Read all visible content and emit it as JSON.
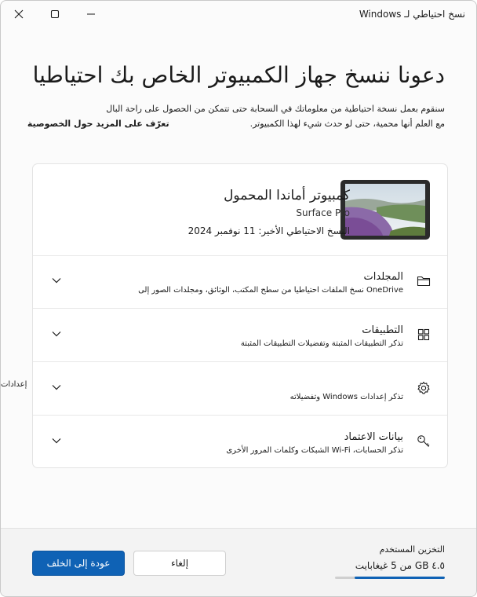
{
  "window": {
    "title": "نسخ احتياطي لـ Windows"
  },
  "heading": "دعونا ننسخ جهاز الكمبيوتر الخاص بك احتياطيا",
  "description": {
    "line1": "سنقوم بعمل نسخة احتياطية من معلوماتك في السحابة حتى تتمكن من الحصول على راحة البال",
    "line2": "مع العلم أنها محمية، حتى لو حدث شيء لهذا الكمبيوتر.",
    "privacy_link": "تعرّف على المزيد حول الخصوصية"
  },
  "device": {
    "name": "كمبيوتر أماندا المحمول",
    "model": "Surface Pro",
    "last_backup": "النسخ الاحتياطي الأخير: 11 نوفمبر 2024"
  },
  "sections": [
    {
      "title": "المجلدات",
      "subtitle": "OneDrive نسخ الملفات احتياطيا من سطح المكتب، الوثائق، ومجلدات الصور إلى",
      "icon": "folder-icon"
    },
    {
      "title": "التطبيقات",
      "subtitle": "تذكر التطبيقات المثبتة وتفضيلات التطبيقات المثبتة",
      "icon": "apps-icon"
    },
    {
      "title": "",
      "subtitle": "تذكر إعدادات Windows وتفضيلاته",
      "overflow": "إعدادات",
      "icon": "gear-icon"
    },
    {
      "title": "بيانات الاعتماد",
      "subtitle": "تذكر الحسابات، Wi-Fi الشبكات وكلمات المرور الأخرى",
      "icon": "key-icon"
    }
  ],
  "footer": {
    "storage_label": "التخزين المستخدم",
    "storage_value": "٤.٥ GB من 5 غيغابايت",
    "storage_fraction": 0.82,
    "back_button": "عودة إلى الخلف",
    "cancel_button": "إلغاء"
  },
  "colors": {
    "accent": "#0f62b5"
  }
}
